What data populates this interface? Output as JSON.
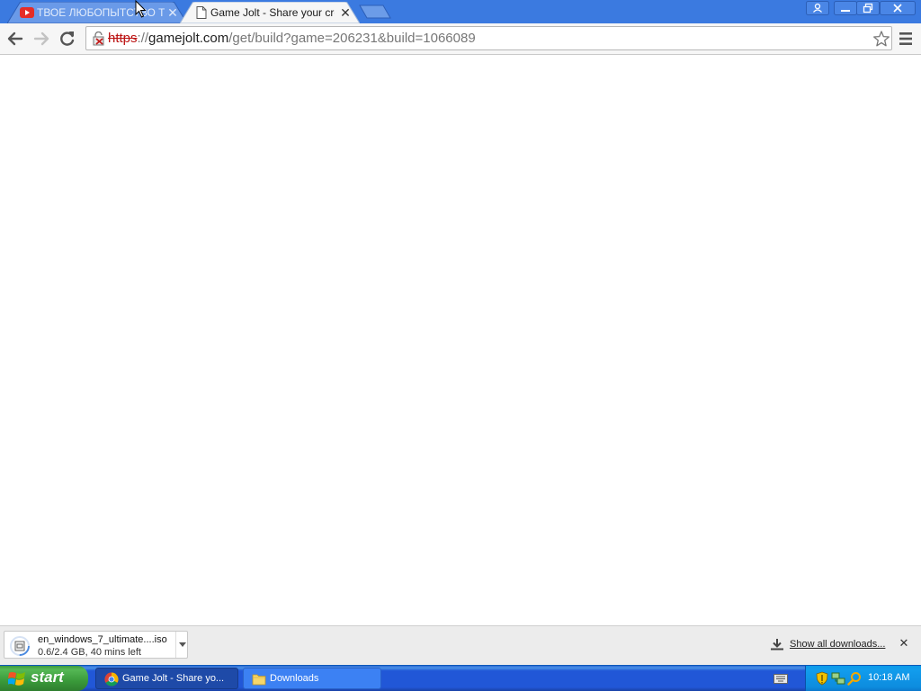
{
  "browser": {
    "tabs": [
      {
        "title": "ТВОЕ ЛЮБОПЫТСТВО ТЕБЯ УБЬЁТ",
        "favicon": "youtube-icon",
        "active": false
      },
      {
        "title": "Game Jolt - Share your creations",
        "favicon": "page-icon",
        "active": true
      }
    ],
    "omnibox": {
      "scheme": "https",
      "separator": "://",
      "host": "gamejolt.com",
      "path": "/get/build?game=206231&build=1066089",
      "security_icon": "broken-lock-icon"
    }
  },
  "download_shelf": {
    "item": {
      "filename": "en_windows_7_ultimate....iso",
      "status": "0.6/2.4 GB, 40 mins left",
      "icon": "disc-image-icon"
    },
    "show_all_label": "Show all downloads..."
  },
  "taskbar": {
    "start_label": "start",
    "tasks": [
      {
        "label": "Game Jolt - Share yo...",
        "icon": "chrome-icon",
        "active": true
      },
      {
        "label": "Downloads",
        "icon": "folder-icon",
        "active": false
      }
    ],
    "clock": "10:18 AM"
  },
  "colors": {
    "tabstrip": "#3b7ae0",
    "scheme_strike": "#bb1111",
    "taskbar": "#2157d7",
    "start_button": "#3a9a3a",
    "tray": "#0d8cde"
  }
}
